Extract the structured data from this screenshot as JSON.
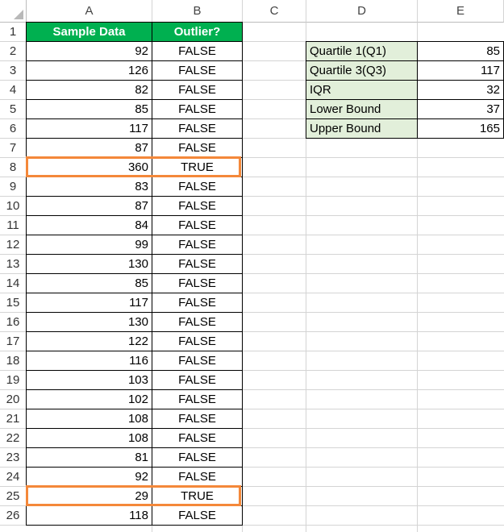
{
  "columns": [
    "A",
    "B",
    "C",
    "D",
    "E"
  ],
  "rows": [
    "1",
    "2",
    "3",
    "4",
    "5",
    "6",
    "7",
    "8",
    "9",
    "10",
    "11",
    "12",
    "13",
    "14",
    "15",
    "16",
    "17",
    "18",
    "19",
    "20",
    "21",
    "22",
    "23",
    "24",
    "25",
    "26"
  ],
  "headers": {
    "a1": "Sample Data",
    "b1": "Outlier?"
  },
  "data": [
    {
      "value": "92",
      "outlier": "FALSE"
    },
    {
      "value": "126",
      "outlier": "FALSE"
    },
    {
      "value": "82",
      "outlier": "FALSE"
    },
    {
      "value": "85",
      "outlier": "FALSE"
    },
    {
      "value": "117",
      "outlier": "FALSE"
    },
    {
      "value": "87",
      "outlier": "FALSE"
    },
    {
      "value": "360",
      "outlier": "TRUE"
    },
    {
      "value": "83",
      "outlier": "FALSE"
    },
    {
      "value": "87",
      "outlier": "FALSE"
    },
    {
      "value": "84",
      "outlier": "FALSE"
    },
    {
      "value": "99",
      "outlier": "FALSE"
    },
    {
      "value": "130",
      "outlier": "FALSE"
    },
    {
      "value": "85",
      "outlier": "FALSE"
    },
    {
      "value": "117",
      "outlier": "FALSE"
    },
    {
      "value": "130",
      "outlier": "FALSE"
    },
    {
      "value": "122",
      "outlier": "FALSE"
    },
    {
      "value": "116",
      "outlier": "FALSE"
    },
    {
      "value": "103",
      "outlier": "FALSE"
    },
    {
      "value": "102",
      "outlier": "FALSE"
    },
    {
      "value": "108",
      "outlier": "FALSE"
    },
    {
      "value": "108",
      "outlier": "FALSE"
    },
    {
      "value": "81",
      "outlier": "FALSE"
    },
    {
      "value": "92",
      "outlier": "FALSE"
    },
    {
      "value": "29",
      "outlier": "TRUE"
    },
    {
      "value": "118",
      "outlier": "FALSE"
    }
  ],
  "stats": [
    {
      "label": "Quartile 1(Q1)",
      "value": "85"
    },
    {
      "label": "Quartile 3(Q3)",
      "value": "117"
    },
    {
      "label": "IQR",
      "value": "32"
    },
    {
      "label": "Lower Bound",
      "value": "37"
    },
    {
      "label": "Upper Bound",
      "value": "165"
    }
  ],
  "highlighted_rows": [
    "8",
    "25"
  ],
  "colors": {
    "header_fill": "#00b050",
    "label_fill": "#e2efda",
    "highlight_border": "#f4883a",
    "gridline": "#d4d4d4"
  }
}
